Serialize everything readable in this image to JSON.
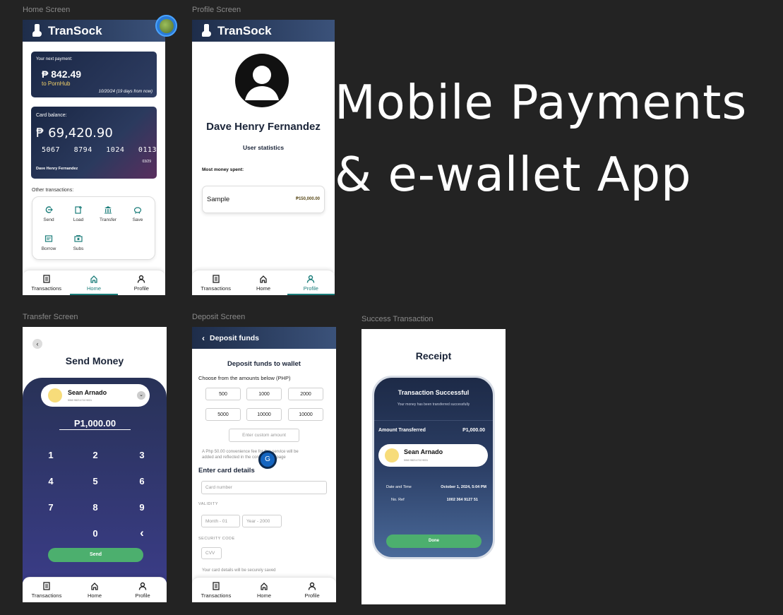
{
  "labels": {
    "home": "Home Screen",
    "profile": "Profile Screen",
    "transfer": "Transfer Screen",
    "deposit": "Deposit Screen",
    "success": "Success Transaction"
  },
  "brand": "TranSock",
  "headline": {
    "line1": "Mobile Payments",
    "line2": "& e-wallet App"
  },
  "nav": {
    "transactions": "Transactions",
    "home": "Home",
    "profile": "Profile"
  },
  "home": {
    "next_payment_label": "Your next payment:",
    "next_payment_amount": "₱ 842.49",
    "next_payment_to": "to PornHub",
    "next_payment_date": "10/20/24 (19 days from now)",
    "balance_label": "Card balance:",
    "balance": "₱ 69,420.90",
    "card_number": "5067   8794   1024   0113",
    "card_expiry": "03/29",
    "card_holder": "Dave Henry Fernandez",
    "other_label": "Other transactions:",
    "tx": [
      "Send",
      "Load",
      "Transfer",
      "Save",
      "Borrow",
      "Subs"
    ]
  },
  "profile": {
    "name": "Dave Henry Fernandez",
    "stats_label": "User statistics",
    "most_spent_label": "Most money spent:",
    "sample_label": "Sample",
    "sample_value": "₱150,000.00"
  },
  "transfer": {
    "title": "Send Money",
    "recipient": "Sean Arnado",
    "recipient_no": "5060 9823 4710 9031",
    "amount": "P1,000.00",
    "keys": [
      "1",
      "2",
      "3",
      "4",
      "5",
      "6",
      "7",
      "8",
      "9",
      "0",
      "‹"
    ],
    "send": "Send"
  },
  "deposit": {
    "header": "Deposit funds",
    "title": "Deposit funds to wallet",
    "choose": "Choose from the amounts below (PHP)",
    "amounts": [
      "500",
      "1000",
      "2000",
      "5000",
      "10000",
      "10000"
    ],
    "custom_placeholder": "Enter custom amount",
    "fee_note1": "A Php 50.00 convenience fee for this service will be",
    "fee_note2": "added and reflected in the confirmation page",
    "card_details": "Enter card details",
    "card_number_ph": "Card number",
    "validity": "VALIDITY",
    "month_ph": "Month - 01",
    "year_ph": "Year - 2000",
    "security": "SECURITY CODE",
    "cvv_ph": "CVV",
    "saved_note": "Your card details will be securely saved",
    "fab_letter": "G"
  },
  "receipt": {
    "title": "Receipt",
    "status": "Transaction Successful",
    "sub": "Your money has been transferred successfully",
    "amount_label": "Amount Transferred",
    "amount": "P1,000.00",
    "recipient": "Sean Arnado",
    "recipient_no": "5060 9823 4710 9031",
    "date_label": "Date and Time",
    "date": "October 1, 2024, 5:04 PM",
    "ref_label": "No. Ref",
    "ref": "1002 364 9127 51",
    "done": "Done"
  },
  "colors": {
    "accent": "#1b7d7a",
    "header": "#1e2d4a",
    "green": "#4caf6e",
    "keypad": "#2f3470"
  }
}
